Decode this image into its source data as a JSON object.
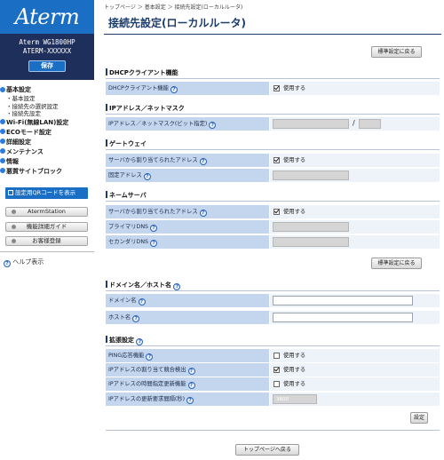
{
  "sidebar": {
    "logo": "Aterm",
    "model_line1": "Aterm WG1800HP",
    "model_line2": "ATERM-XXXXXX",
    "save_label": "保存",
    "nav": [
      {
        "type": "main",
        "label": "基本設定"
      },
      {
        "type": "sub",
        "label": "・基本設定"
      },
      {
        "type": "sub",
        "label": "・接続先の選択設定"
      },
      {
        "type": "sub",
        "label": "・接続先設定"
      },
      {
        "type": "main",
        "label": "Wi-Fi(無線LAN)設定"
      },
      {
        "type": "main",
        "label": "ECOモード設定"
      },
      {
        "type": "main",
        "label": "詳細設定"
      },
      {
        "type": "main",
        "label": "メンテナンス"
      },
      {
        "type": "main",
        "label": "情報"
      },
      {
        "type": "main",
        "label": "悪質サイトブロック"
      }
    ],
    "qr_label": "設定用QRコードを表示",
    "buttons": [
      "AtermStation",
      "機能詳細ガイド",
      "お客様登録"
    ],
    "help_label": "ヘルプ表示"
  },
  "breadcrumb": "トップページ ＞ 基本設定 ＞ 接続先設定(ローカルルータ)",
  "page_title": "接続先設定(ローカルルータ)",
  "reset_label": "標準設定に戻る",
  "help_icon_glyph": "?",
  "dhcp": {
    "title": "DHCPクライアント機能",
    "row_label": "DHCPクライアント機能",
    "check_label": "使用する",
    "checked": true
  },
  "ip": {
    "title": "IPアドレス／ネットマスク",
    "row_label": "IPアドレス／ネットマスク(ビット指定)",
    "separator": "/"
  },
  "gateway": {
    "title": "ゲートウェイ",
    "rows": [
      {
        "label": "サーバから割り当てられたアドレス",
        "check_label": "使用する",
        "checked": true
      },
      {
        "label": "固定アドレス"
      }
    ]
  },
  "nameserver": {
    "title": "ネームサーバ",
    "rows": [
      {
        "label": "サーバから割り当てられたアドレス",
        "check_label": "使用する",
        "checked": true
      },
      {
        "label": "プライマリDNS"
      },
      {
        "label": "セカンダリDNS"
      }
    ]
  },
  "domain": {
    "title": "ドメイン名／ホスト名",
    "rows": [
      {
        "label": "ドメイン名",
        "value": ""
      },
      {
        "label": "ホスト名",
        "value": ""
      }
    ]
  },
  "extended": {
    "title": "拡張設定",
    "rows": [
      {
        "label": "PING応答機能",
        "check_label": "使用する",
        "checked": false
      },
      {
        "label": "IPアドレスの割り当て競合検出",
        "check_label": "使用する",
        "checked": true
      },
      {
        "label": "IPアドレスの時間指定更新機能",
        "check_label": "使用する",
        "checked": false
      },
      {
        "label": "IPアドレスの更新要求間隔(秒)",
        "value": "3600"
      }
    ]
  },
  "set_label": "設定",
  "back_top_label": "トップページへ戻る"
}
